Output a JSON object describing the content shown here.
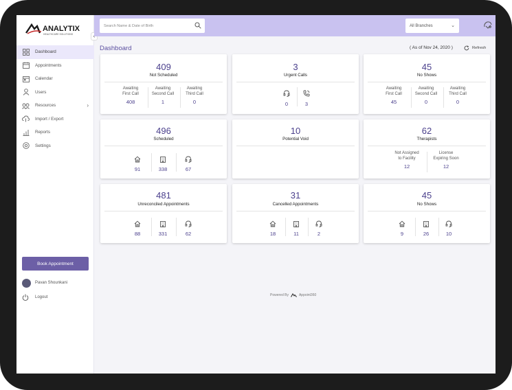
{
  "brand": {
    "name": "ANALYTIX",
    "tagline": "HEALTHCARE SOLUTIONS"
  },
  "sidebar": {
    "items": [
      {
        "label": "Dashboard",
        "icon": "grid-icon",
        "active": true
      },
      {
        "label": "Appointments",
        "icon": "appointments-icon"
      },
      {
        "label": "Calendar",
        "icon": "calendar-icon"
      },
      {
        "label": "Users",
        "icon": "user-icon"
      },
      {
        "label": "Resources",
        "icon": "resources-icon",
        "has_submenu": true
      },
      {
        "label": "Import / Export",
        "icon": "cloud-icon"
      },
      {
        "label": "Reports",
        "icon": "bar-chart-icon"
      },
      {
        "label": "Settings",
        "icon": "gear-icon"
      }
    ],
    "book_button": "Book Appointment",
    "user_name": "Pavan Shounkani",
    "logout": "Logout"
  },
  "topbar": {
    "search_placeholder": "Search Name & Date of Birth",
    "branch_select": "All Branches"
  },
  "page": {
    "title": "Dashboard",
    "as_of": "( As of Nov 24, 2020 )",
    "refresh": "Refresh"
  },
  "cards": {
    "not_scheduled": {
      "value": "409",
      "label": "Not Scheduled",
      "cols": [
        {
          "label": "Awaiting First Call",
          "l1": "Awaiting",
          "l2": "First Call",
          "value": "408"
        },
        {
          "label": "Awaiting Second Call",
          "l1": "Awaiting",
          "l2": "Second Call",
          "value": "1"
        },
        {
          "label": "Awaiting Third Call",
          "l1": "Awaiting",
          "l2": "Third Call",
          "value": "0"
        }
      ]
    },
    "urgent_calls": {
      "value": "3",
      "label": "Urgent Calls",
      "cols": [
        {
          "icon": "headset-icon",
          "value": "0"
        },
        {
          "icon": "phone-icon",
          "value": "3"
        }
      ]
    },
    "no_shows_top": {
      "value": "45",
      "label": "No Shows",
      "cols": [
        {
          "l1": "Awaiting",
          "l2": "First Call",
          "value": "45"
        },
        {
          "l1": "Awaiting",
          "l2": "Second Call",
          "value": "0"
        },
        {
          "l1": "Awaiting",
          "l2": "Third Call",
          "value": "0"
        }
      ]
    },
    "scheduled": {
      "value": "496",
      "label": "Scheduled",
      "cols": [
        {
          "icon": "home-icon",
          "value": "91"
        },
        {
          "icon": "building-icon",
          "value": "338"
        },
        {
          "icon": "headset-icon",
          "value": "67"
        }
      ]
    },
    "potential_void": {
      "value": "10",
      "label": "Potential Void"
    },
    "therapists": {
      "value": "62",
      "label": "Therapists",
      "cols": [
        {
          "l1": "Not Assigned",
          "l2": "to Facility",
          "value": "12"
        },
        {
          "l1": "License",
          "l2": "Expiring Soon",
          "value": "12"
        }
      ]
    },
    "unreconciled": {
      "value": "481",
      "label": "Unreconciled Appointments",
      "cols": [
        {
          "icon": "home-icon",
          "value": "88"
        },
        {
          "icon": "building-icon",
          "value": "331"
        },
        {
          "icon": "headset-icon",
          "value": "62"
        }
      ]
    },
    "cancelled": {
      "value": "31",
      "label": "Cancelled Appointments",
      "cols": [
        {
          "icon": "home-icon",
          "value": "18"
        },
        {
          "icon": "building-icon",
          "value": "11"
        },
        {
          "icon": "headset-icon",
          "value": "2"
        }
      ]
    },
    "no_shows_bottom": {
      "value": "45",
      "label": "No Shows",
      "cols": [
        {
          "icon": "home-icon",
          "value": "9"
        },
        {
          "icon": "building-icon",
          "value": "26"
        },
        {
          "icon": "headset-icon",
          "value": "10"
        }
      ]
    }
  },
  "footer": {
    "powered_by": "Powered By",
    "product": "Appoint360"
  },
  "colors": {
    "accent": "#5b4fa0",
    "topbar": "#c9c2f0",
    "button": "#6c5fa6",
    "active_nav": "#ebe8fb"
  }
}
